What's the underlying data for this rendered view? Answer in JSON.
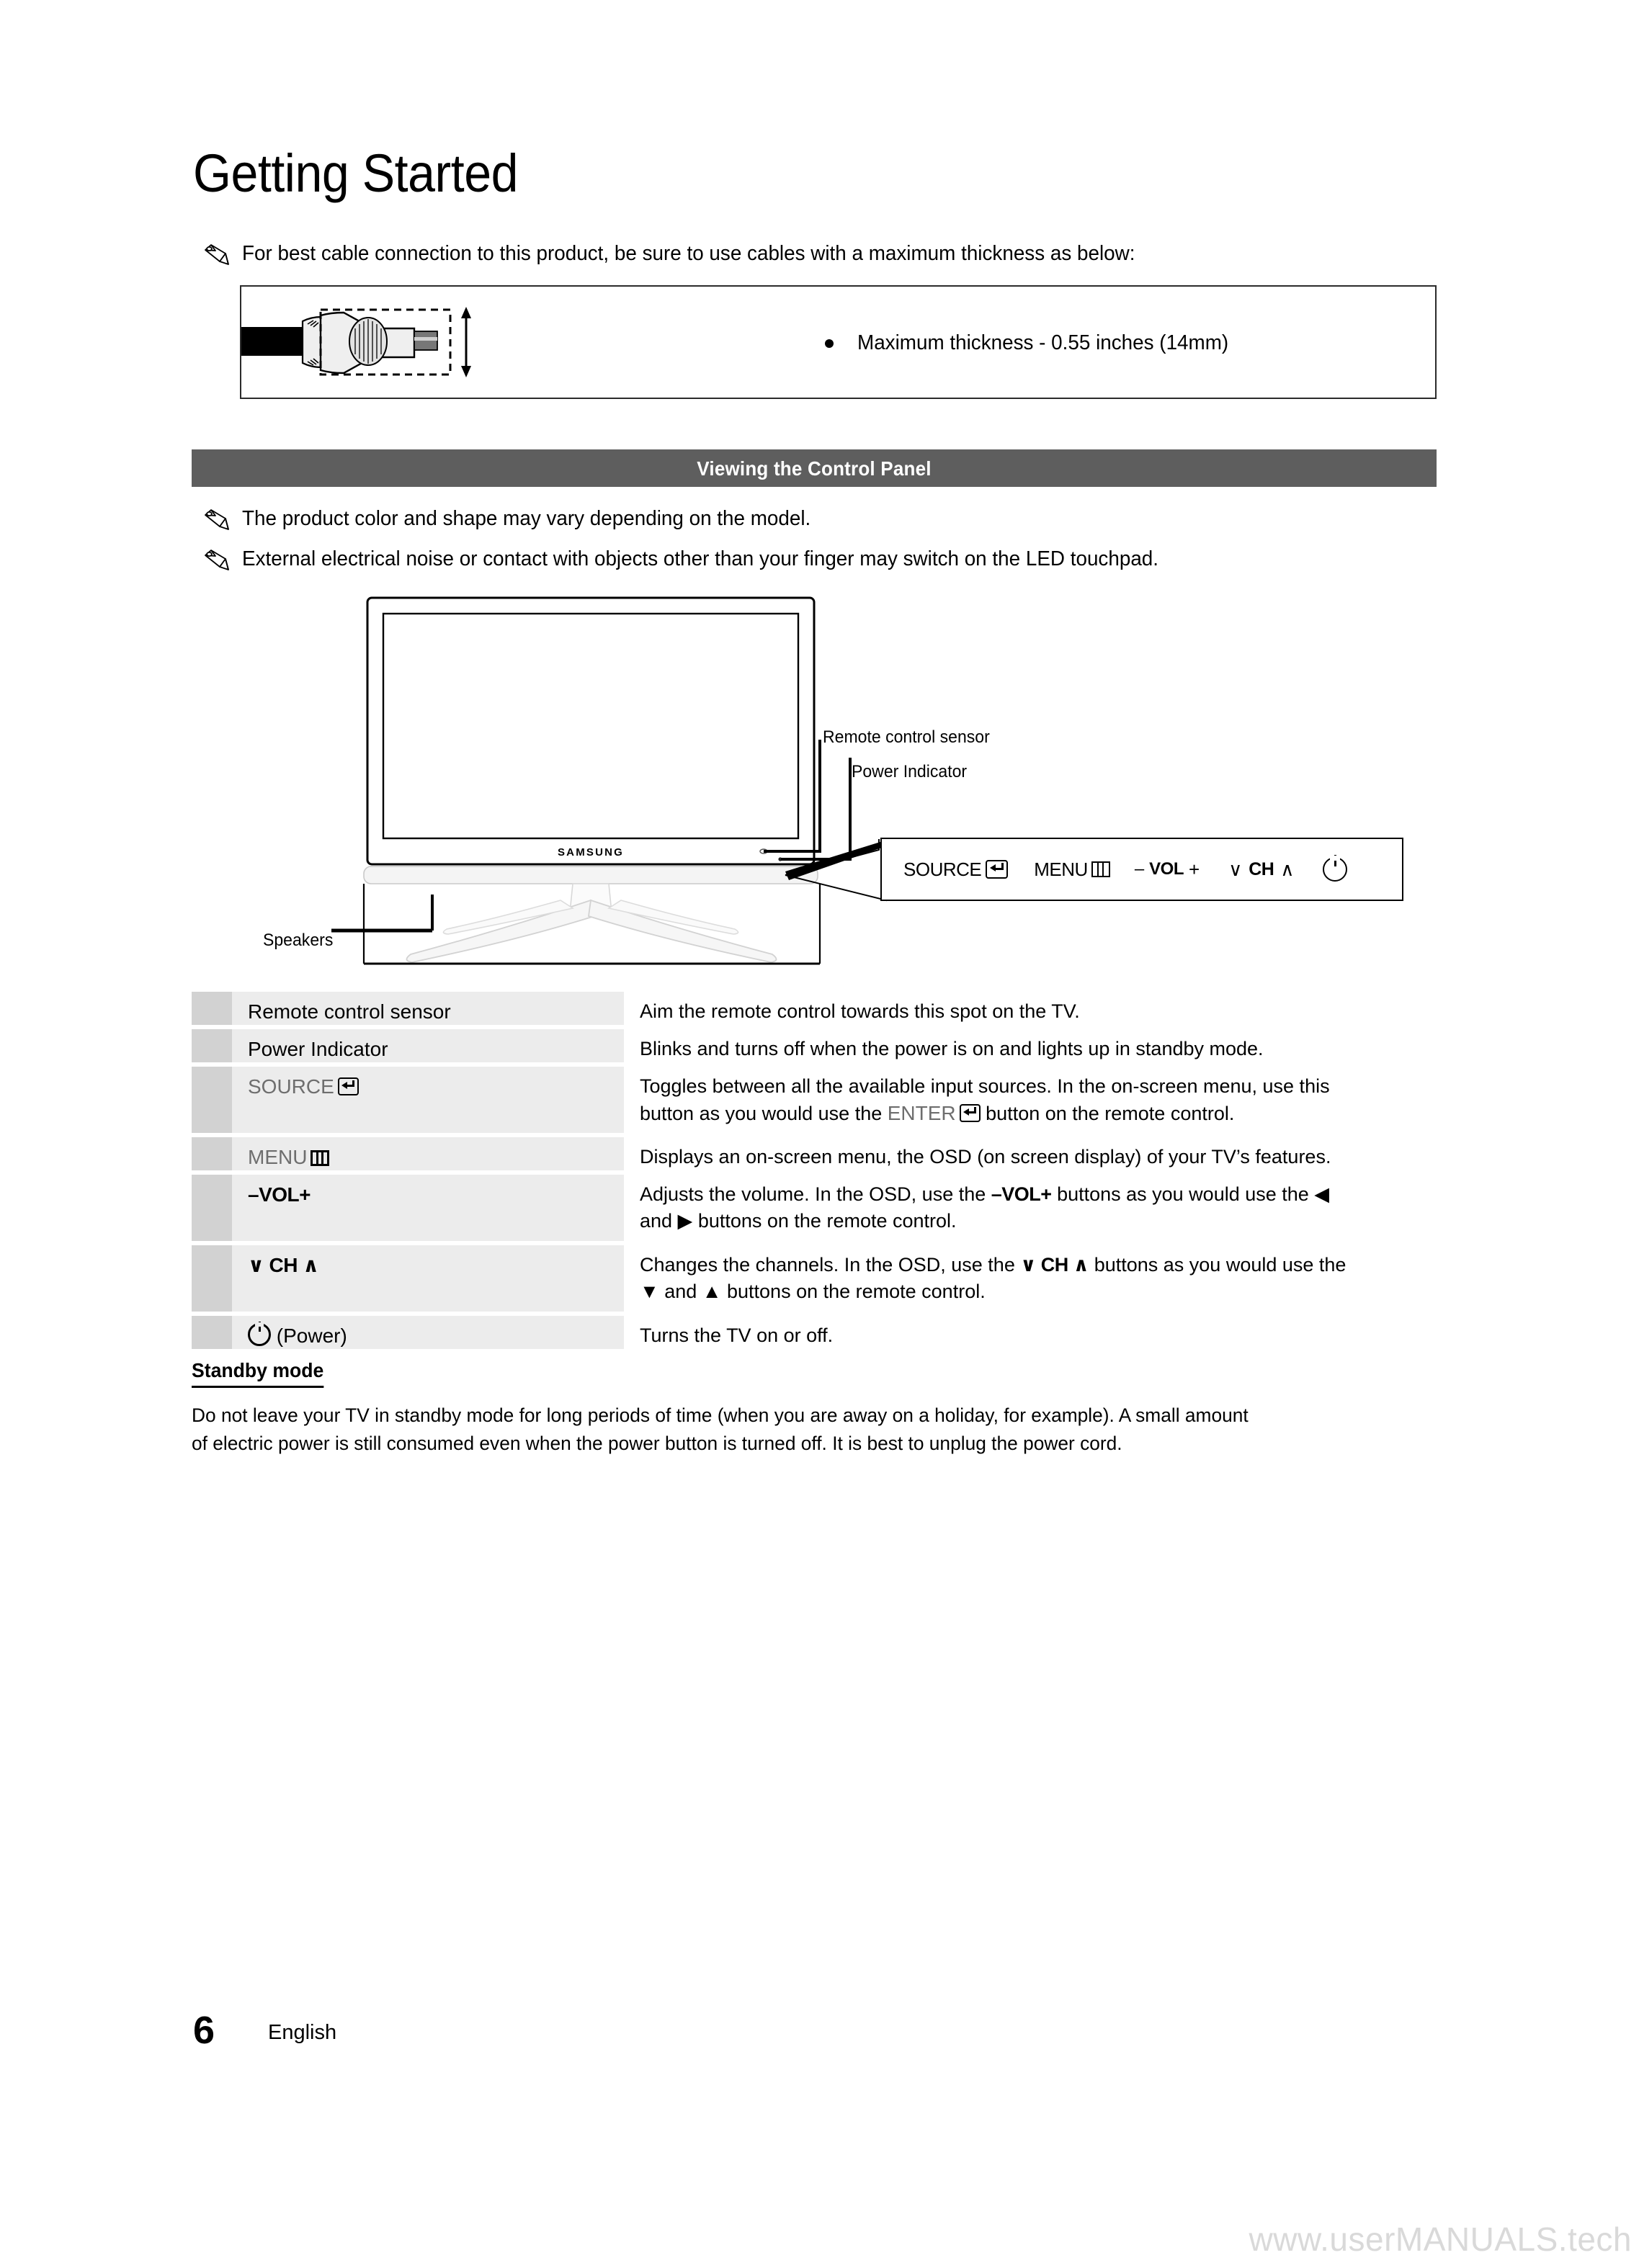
{
  "page": {
    "title": "Getting Started",
    "page_number": "6",
    "language": "English",
    "watermark": "www.userMANUALS.tech"
  },
  "notes": {
    "cable": "For best cable connection to this product, be sure to use cables with a maximum thickness as below:",
    "color_shape": "The product color and shape may vary depending on the model.",
    "noise": "External electrical noise or contact with objects other than your finger may switch on the LED touchpad."
  },
  "cable_box": {
    "bullet": "Maximum thickness - 0.55 inches (14mm)"
  },
  "section": {
    "heading": "Viewing the Control Panel",
    "bar_color": "#5e5e5e"
  },
  "diagram": {
    "brand": "SAMSUNG",
    "callouts": {
      "remote_sensor": "Remote control sensor",
      "power_indicator": "Power Indicator",
      "speakers": "Speakers"
    }
  },
  "control_panel": {
    "source_label": "SOURCE",
    "menu_label": "MENU",
    "vol_minus": "–",
    "vol_label": "VOL",
    "vol_plus": "+",
    "ch_down": "∨",
    "ch_label": "CH",
    "ch_up": "∧",
    "power_icon": "power-icon"
  },
  "table": {
    "rows": [
      {
        "label": "Remote control sensor",
        "label_style": "plain",
        "desc_1": "Aim the remote control towards this spot on the TV.",
        "desc_2": ""
      },
      {
        "label": "Power Indicator",
        "label_style": "plain",
        "desc_1": "Blinks and turns off when the power is on and lights up in standby mode.",
        "desc_2": ""
      },
      {
        "label": "SOURCE",
        "label_style": "gray-enter",
        "desc_1": "Toggles between all the available input sources. In the on-screen menu, use this",
        "desc_2a": "button as you would use the ",
        "desc_2b": "ENTER",
        "desc_2c": " button on the remote control."
      },
      {
        "label": "MENU",
        "label_style": "gray-menu",
        "desc_1": "Displays an on-screen menu, the OSD (on screen display) of your TV’s features.",
        "desc_2": ""
      },
      {
        "label_minus": "–",
        "label_vol": "VOL",
        "label_plus": "+",
        "label_style": "bold-vol",
        "desc_1a": "Adjusts the volume. In the OSD, use the ",
        "desc_1b": "–VOL+",
        "desc_1c": " buttons as you would use the ◀",
        "desc_2": "and ▶ buttons on the remote control."
      },
      {
        "label_down": "∨",
        "label_ch": "CH",
        "label_up": "∧",
        "label_style": "bold-ch",
        "desc_1a": "Changes the channels. In the OSD, use the ",
        "desc_1b": "∨ CH ∧",
        "desc_1c": " buttons as you would use the",
        "desc_2": "▼ and ▲ buttons on the remote control."
      },
      {
        "label": "(Power)",
        "label_style": "power",
        "desc_1": "Turns the TV on or off.",
        "desc_2": ""
      }
    ]
  },
  "standby": {
    "heading": "Standby mode",
    "line1": "Do not leave your TV in standby mode for long periods of time (when you are away on a holiday, for example). A small amount",
    "line2": "of electric power is still consumed even when the power button is turned off. It is best to unplug the power cord."
  }
}
